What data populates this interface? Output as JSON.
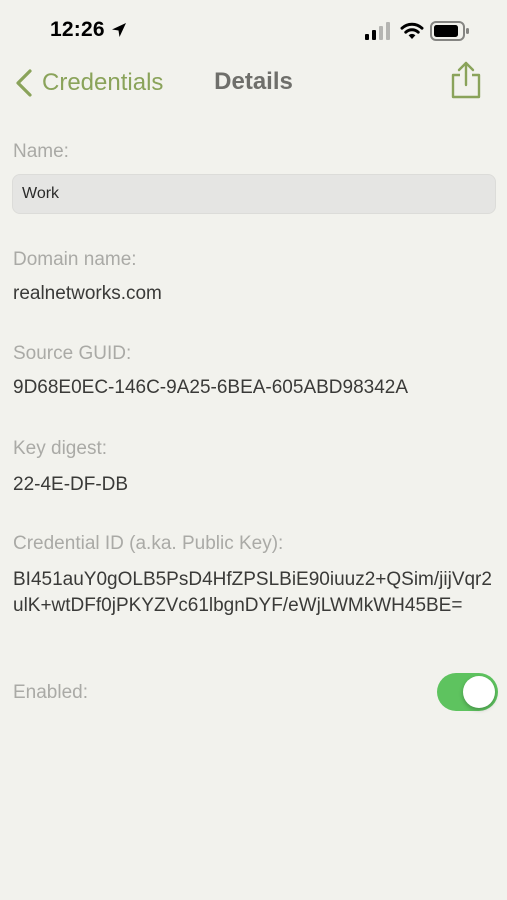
{
  "status_bar": {
    "time": "12:26"
  },
  "nav": {
    "back_label": "Credentials",
    "title": "Details"
  },
  "fields": {
    "name_label": "Name:",
    "name_value": "Work",
    "domain_label": "Domain name:",
    "domain_value": "realnetworks.com",
    "guid_label": "Source GUID:",
    "guid_value": "9D68E0EC-146C-9A25-6BEA-605ABD98342A",
    "digest_label": "Key digest:",
    "digest_value": "22-4E-DF-DB",
    "credential_label": "Credential ID (a.ka. Public Key):",
    "credential_value": "BI451auY0gOLB5PsD4HfZPSLBiE90iuuz2+QSim/jijVqr2ulK+wtDFf0jPKYZVc61lbgnDYF/eWjLWMkWH45BE=",
    "enabled_label": "Enabled:",
    "enabled": true
  },
  "colors": {
    "accent": "#8aa35a",
    "toggle_on": "#5ec35f",
    "background": "#f2f2ed"
  },
  "icons": [
    "location-arrow-icon",
    "cellular-signal-icon",
    "wifi-icon",
    "battery-icon",
    "chevron-left-icon",
    "share-icon"
  ]
}
